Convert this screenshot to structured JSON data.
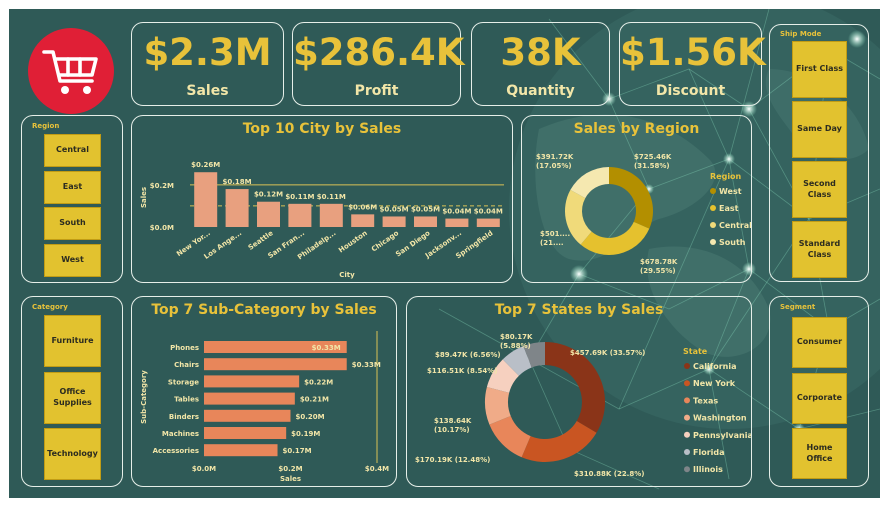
{
  "colors": {
    "gold": "#e8c23a",
    "salmon": "#e8a07f",
    "orange": "#e8865a",
    "bg": "#2f5a57"
  },
  "logo": {
    "icon": "shopping-cart-icon"
  },
  "kpis": [
    {
      "value": "$2.3M",
      "label": "Sales"
    },
    {
      "value": "$286.4K",
      "label": "Profit"
    },
    {
      "value": "38K",
      "label": "Quantity"
    },
    {
      "value": "$1.56K",
      "label": "Discount"
    }
  ],
  "slicers": {
    "region": {
      "title": "Region",
      "items": [
        "Central",
        "East",
        "South",
        "West"
      ]
    },
    "category": {
      "title": "Category",
      "items": [
        "Furniture",
        "Office\nSupplies",
        "Technology"
      ]
    },
    "ship_mode": {
      "title": "Ship Mode",
      "items": [
        "First Class",
        "Same Day",
        "Second\nClass",
        "Standard\nClass"
      ]
    },
    "segment": {
      "title": "Segment",
      "items": [
        "Consumer",
        "Corporate",
        "Home\nOffice"
      ]
    }
  },
  "chart_data": [
    {
      "id": "city",
      "type": "bar",
      "title": "Top 10 City by Sales",
      "xlabel": "City",
      "ylabel": "Sales",
      "categories": [
        "New Yor...",
        "Los Ange...",
        "Seattle",
        "San Fran...",
        "Philadelp...",
        "Houston",
        "Chicago",
        "San Diego",
        "Jacksonv...",
        "Springfield"
      ],
      "values": [
        0.26,
        0.18,
        0.12,
        0.11,
        0.11,
        0.06,
        0.05,
        0.05,
        0.04,
        0.04
      ],
      "data_labels": [
        "$0.26M",
        "$0.18M",
        "$0.12M",
        "$0.11M",
        "$0.11M",
        "$0.06M",
        "$0.05M",
        "$0.05M",
        "$0.04M",
        "$0.04M"
      ],
      "yticks": [
        "$0.0M",
        "$0.2M"
      ],
      "ylim": [
        0,
        0.28
      ],
      "reference_line_solid": 0.2,
      "reference_line_dashed": 0.1
    },
    {
      "id": "region",
      "type": "pie",
      "title": "Sales by Region",
      "legend_title": "Region",
      "legend_position": "right",
      "labels": [
        "West",
        "East",
        "Central",
        "South"
      ],
      "values": [
        725.46,
        678.78,
        501.24,
        391.72
      ],
      "data_labels": [
        "$725.46K\n(31.58%)",
        "$678.78K\n(29.55%)",
        "$501....\n(21....",
        "$391.72K\n(17.05%)"
      ],
      "colors": [
        "#b38f00",
        "#e5c12e",
        "#f0da7a",
        "#f5e8b0"
      ]
    },
    {
      "id": "subcat",
      "type": "bar",
      "orientation": "horizontal",
      "title": "Top 7 Sub-Category by Sales",
      "xlabel": "Sales",
      "ylabel": "Sub-Category",
      "categories": [
        "Phones",
        "Chairs",
        "Storage",
        "Tables",
        "Binders",
        "Machines",
        "Accessories"
      ],
      "values": [
        0.33,
        0.33,
        0.22,
        0.21,
        0.2,
        0.19,
        0.17
      ],
      "data_labels": [
        "$0.33M",
        "$0.33M",
        "$0.22M",
        "$0.21M",
        "$0.20M",
        "$0.19M",
        "$0.17M"
      ],
      "xticks": [
        "$0.0M",
        "$0.2M",
        "$0.4M"
      ],
      "xlim": [
        0,
        0.4
      ]
    },
    {
      "id": "states",
      "type": "pie",
      "title": "Top 7 States by Sales",
      "legend_title": "State",
      "legend_position": "right",
      "labels": [
        "California",
        "New York",
        "Texas",
        "Washington",
        "Pennsylvania",
        "Florida",
        "Illinois"
      ],
      "values": [
        457.69,
        310.88,
        170.19,
        138.64,
        116.51,
        89.47,
        80.17
      ],
      "data_labels": [
        "$457.69K (33.57%)",
        "$310.88K (22.8%)",
        "$170.19K (12.48%)",
        "$138.64K\n(10.17%)",
        "$116.51K (8.54%)",
        "$89.47K (6.56%)",
        "$80.17K\n(5.88%)"
      ],
      "colors": [
        "#8a3418",
        "#c95522",
        "#e8865a",
        "#f0ab88",
        "#f6d0bf",
        "#b9bfc7",
        "#7f8589"
      ]
    }
  ]
}
